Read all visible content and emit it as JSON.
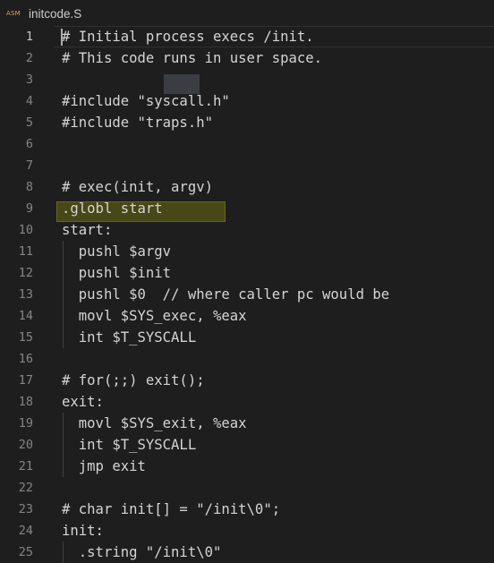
{
  "tab": {
    "icon_label": "ASM",
    "filename": "initcode.S"
  },
  "colors": {
    "background": "#1e1e1e",
    "text": "#d4d4d4",
    "line_number": "#858585",
    "active_line_number": "#c6c6c6",
    "find_highlight": "#eaea00"
  },
  "editor": {
    "active_line": 1,
    "lines": [
      {
        "number": "1",
        "text": "# Initial process execs /init."
      },
      {
        "number": "2",
        "text": "# This code runs in user space."
      },
      {
        "number": "3",
        "text": ""
      },
      {
        "number": "4",
        "text": "#include \"syscall.h\""
      },
      {
        "number": "5",
        "text": "#include \"traps.h\""
      },
      {
        "number": "6",
        "text": ""
      },
      {
        "number": "7",
        "text": ""
      },
      {
        "number": "8",
        "text": "# exec(init, argv)"
      },
      {
        "number": "9",
        "text": ".globl start"
      },
      {
        "number": "10",
        "text": "start:"
      },
      {
        "number": "11",
        "text": "  pushl $argv"
      },
      {
        "number": "12",
        "text": "  pushl $init"
      },
      {
        "number": "13",
        "text": "  pushl $0  // where caller pc would be"
      },
      {
        "number": "14",
        "text": "  movl $SYS_exec, %eax"
      },
      {
        "number": "15",
        "text": "  int $T_SYSCALL"
      },
      {
        "number": "16",
        "text": ""
      },
      {
        "number": "17",
        "text": "# for(;;) exit();"
      },
      {
        "number": "18",
        "text": "exit:"
      },
      {
        "number": "19",
        "text": "  movl $SYS_exit, %eax"
      },
      {
        "number": "20",
        "text": "  int $T_SYSCALL"
      },
      {
        "number": "21",
        "text": "  jmp exit"
      },
      {
        "number": "22",
        "text": ""
      },
      {
        "number": "23",
        "text": "# char init[] = \"/init\\0\";"
      },
      {
        "number": "24",
        "text": "init:"
      },
      {
        "number": "25",
        "text": "  .string \"/init\\0\""
      }
    ]
  }
}
